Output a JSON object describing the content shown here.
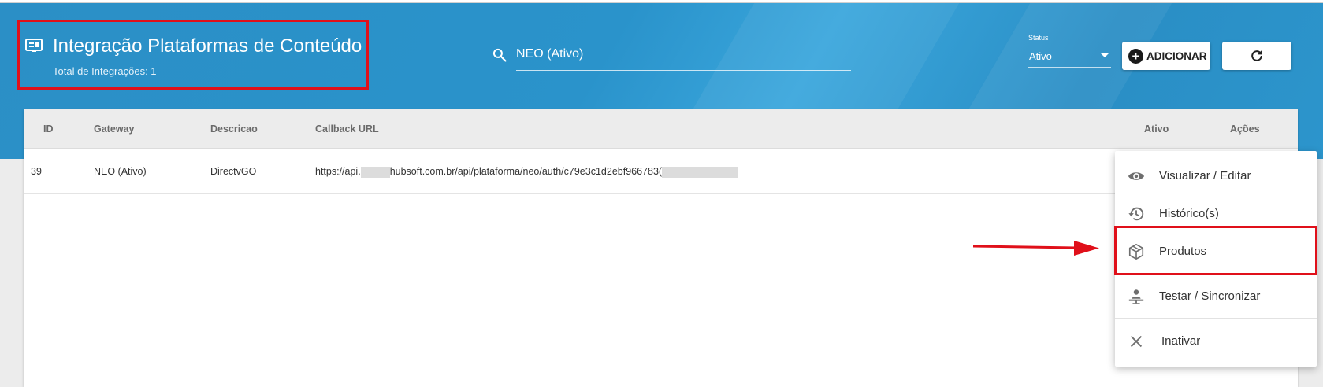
{
  "header": {
    "title": "Integração Plataformas de Conteúdo",
    "subtitle": "Total de Integrações: 1",
    "title_icon": "article-card-icon"
  },
  "search": {
    "value": "NEO (Ativo)",
    "icon": "search-icon"
  },
  "status_filter": {
    "label": "Status",
    "value": "Ativo"
  },
  "toolbar": {
    "add_label": "ADICIONAR",
    "refresh_icon": "refresh-icon"
  },
  "table": {
    "columns": [
      "ID",
      "Gateway",
      "Descricao",
      "Callback URL",
      "Ativo",
      "Ações"
    ],
    "rows": [
      {
        "id": "39",
        "gateway": "NEO (Ativo)",
        "descricao": "DirectvGO",
        "callback_prefix": "https://api.",
        "callback_middle": "hubsoft.com.br/api/plataforma/neo/auth/c79e3c1d2ebf966783("
      }
    ]
  },
  "actions_menu": {
    "items": [
      {
        "label": "Visualizar / Editar",
        "icon": "eye-icon"
      },
      {
        "label": "Histórico(s)",
        "icon": "history-icon"
      },
      {
        "label": "Produtos",
        "icon": "package-icon"
      },
      {
        "label": "Testar / Sincronizar",
        "icon": "sync-test-icon"
      },
      {
        "label": "Inativar",
        "icon": "close-icon"
      }
    ]
  },
  "colors": {
    "header_blue": "#2a8ec5",
    "annotation_red": "#e0101a"
  }
}
